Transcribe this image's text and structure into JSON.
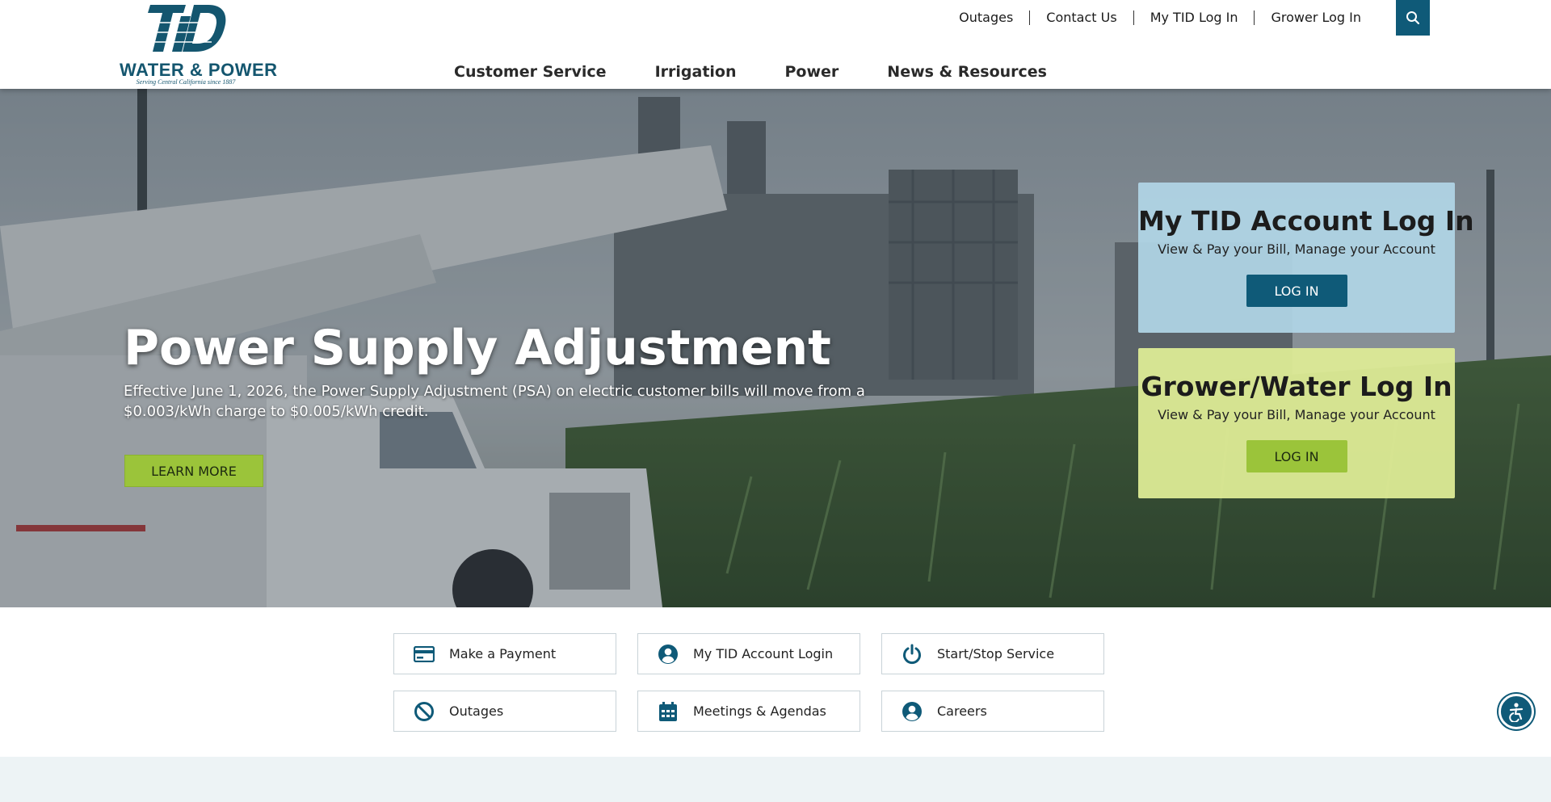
{
  "header": {
    "logo": {
      "monogram": "TID",
      "wordmark": "WATER & POWER",
      "tagline": "Serving Central California since 1887"
    },
    "utility_nav": [
      {
        "label": "Outages"
      },
      {
        "label": "Contact Us"
      },
      {
        "label": "My TID Log In"
      },
      {
        "label": "Grower Log In"
      }
    ],
    "search_icon": "search-icon",
    "main_nav": [
      {
        "label": "Customer Service"
      },
      {
        "label": "Irrigation"
      },
      {
        "label": "Power"
      },
      {
        "label": "News & Resources"
      }
    ]
  },
  "hero": {
    "title": "Power Supply Adjustment",
    "text": "Effective June 1, 2026, the Power Supply Adjustment (PSA) on electric customer bills will move from a $0.003/kWh charge to $0.005/kWh credit.",
    "cta_label": "LEARN MORE"
  },
  "login_cards": [
    {
      "title": "My TID Account Log In",
      "subtitle": "View & Pay your Bill, Manage your Account",
      "button": "LOG IN"
    },
    {
      "title": "Grower/Water Log In",
      "subtitle": "View & Pay your Bill, Manage your Account",
      "button": "LOG IN"
    }
  ],
  "quick_links": [
    {
      "label": "Make a Payment",
      "icon": "credit-card-icon"
    },
    {
      "label": "My TID Account Login",
      "icon": "user-circle-icon"
    },
    {
      "label": "Start/Stop Service",
      "icon": "power-icon"
    },
    {
      "label": "Outages",
      "icon": "ban-icon"
    },
    {
      "label": "Meetings & Agendas",
      "icon": "calendar-icon"
    },
    {
      "label": "Careers",
      "icon": "user-circle-icon"
    }
  ],
  "accessibility_icon": "accessibility-icon",
  "colors": {
    "brand_blue": "#0f5a78",
    "brand_green": "#9bc43a",
    "card_blue": "#b0d5e6",
    "card_green": "#ddeb96"
  }
}
